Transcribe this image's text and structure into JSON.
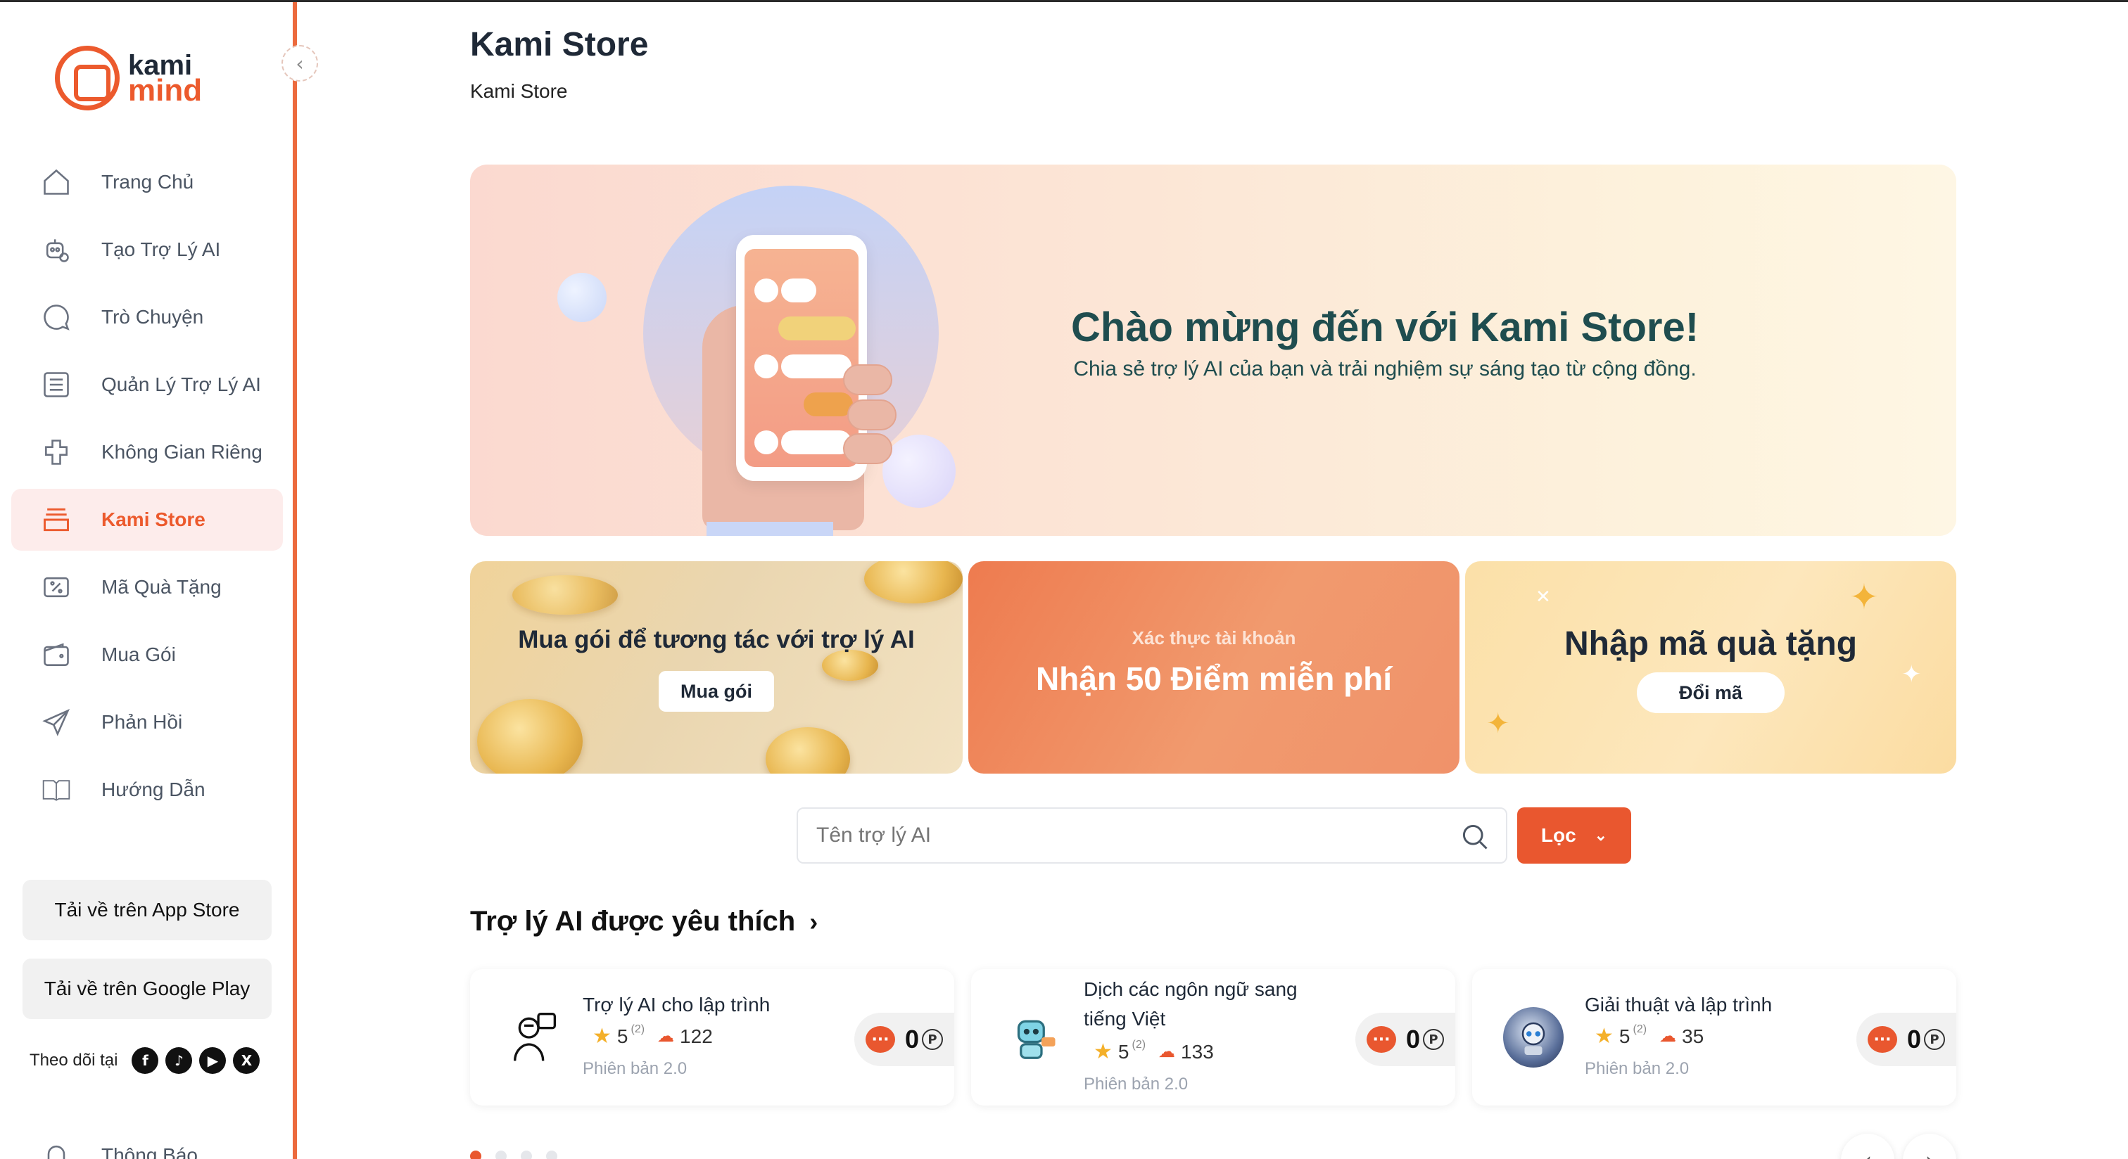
{
  "brand": {
    "line1": "kami",
    "line2": "mind",
    "accent": "#ec5a2d"
  },
  "sidebar": {
    "collapse_icon": "chevron-left-icon",
    "items": [
      {
        "label": "Trang Chủ",
        "icon": "home-icon"
      },
      {
        "label": "Tạo Trợ Lý AI",
        "icon": "robot-icon"
      },
      {
        "label": "Trò Chuyện",
        "icon": "chat-icon"
      },
      {
        "label": "Quản Lý Trợ Lý AI",
        "icon": "list-icon"
      },
      {
        "label": "Không Gian Riêng",
        "icon": "puzzle-icon"
      },
      {
        "label": "Kami Store",
        "icon": "store-icon",
        "active": true
      },
      {
        "label": "Mã Quà Tặng",
        "icon": "coupon-icon"
      },
      {
        "label": "Mua Gói",
        "icon": "wallet-icon"
      },
      {
        "label": "Phản Hồi",
        "icon": "send-icon"
      },
      {
        "label": "Hướng Dẫn",
        "icon": "book-icon"
      }
    ],
    "app_store": "Tải về trên App Store",
    "google_play": "Tải về trên Google Play",
    "follow_label": "Theo dõi tại",
    "socials": [
      "facebook-icon",
      "tiktok-icon",
      "youtube-icon",
      "x-icon"
    ],
    "notifications_label": "Thông Báo"
  },
  "header": {
    "title": "Kami Store",
    "breadcrumb": "Kami Store"
  },
  "hero": {
    "title": "Chào mừng đến với Kami Store!",
    "subtitle": "Chia sẻ trợ lý AI của bạn và trải nghiệm sự sáng tạo từ cộng đồng."
  },
  "promos": {
    "buy": {
      "title": "Mua gói để tương tác với trợ lý AI",
      "button": "Mua gói"
    },
    "verify": {
      "small": "Xác thực tài khoản",
      "title": "Nhận 50 Điểm miễn phí"
    },
    "gift": {
      "title": "Nhập mã quà tặng",
      "button": "Đổi mã"
    }
  },
  "search": {
    "placeholder": "Tên trợ lý AI",
    "filter_label": "Lọc"
  },
  "favorites": {
    "title": "Trợ lý AI được yêu thích",
    "cards": [
      {
        "name": "Trợ lý AI cho lập trình",
        "rating": "5",
        "rating_count": "(2)",
        "uses": "122",
        "version": "Phiên bản 2.0",
        "price": "0"
      },
      {
        "name": "Dịch các ngôn ngữ sang tiếng Việt",
        "rating": "5",
        "rating_count": "(2)",
        "uses": "133",
        "version": "Phiên bản 2.0",
        "price": "0"
      },
      {
        "name": "Giải thuật và lập trình",
        "rating": "5",
        "rating_count": "(2)",
        "uses": "35",
        "version": "Phiên bản 2.0",
        "price": "0"
      }
    ],
    "price_unit": "P"
  }
}
